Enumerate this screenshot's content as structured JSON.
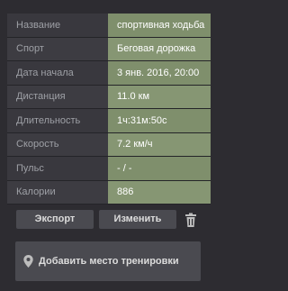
{
  "workout": {
    "rows": [
      {
        "label": "Название",
        "value": "спортивная ходьба"
      },
      {
        "label": "Спорт",
        "value": "Беговая дорожка"
      },
      {
        "label": "Дата начала",
        "value": "3 янв. 2016, 20:00"
      },
      {
        "label": "Дистанция",
        "value": "11.0 км"
      },
      {
        "label": "Длительность",
        "value": "1ч:31м:50с"
      },
      {
        "label": "Скорость",
        "value": "7.2 км/ч"
      },
      {
        "label": "Пульс",
        "value": "- / -"
      },
      {
        "label": "Калории",
        "value": "886"
      }
    ]
  },
  "actions": {
    "export_label": "Экспорт",
    "edit_label": "Изменить",
    "delete_icon": "trash-icon",
    "add_place_label": "Добавить место тренировки",
    "add_place_icon": "map-pin-icon"
  },
  "colors": {
    "background": "#2d2c31",
    "label_cell": "#39383e",
    "value_cell": "#7f8f6c",
    "button": "#4a4a50"
  }
}
